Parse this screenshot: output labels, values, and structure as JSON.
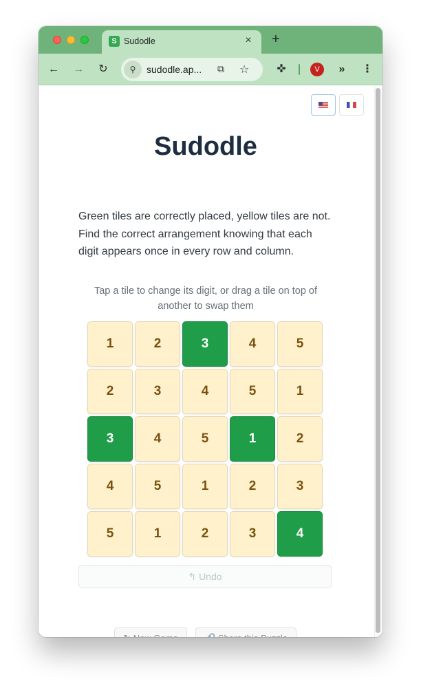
{
  "browser": {
    "tab": {
      "title": "Sudodle",
      "favicon": "S"
    },
    "new_tab": "+",
    "close_tab": "×",
    "url": "sudodle.ap...",
    "avatar_letter": "V",
    "nav": {
      "back": "←",
      "forward": "→",
      "reload": "↻"
    },
    "icons": {
      "site_info": "⚲",
      "install": "⧉",
      "bookmark": "☆",
      "extensions": "✜",
      "more_extensions": "»",
      "menu": "⋮"
    }
  },
  "page": {
    "title": "Sudodle",
    "description": "Green tiles are correctly placed, yellow tiles are not. Find the correct arrangement knowing that each digit appears once in every row and column.",
    "hint": "Tap a tile to change its digit, or drag a tile on top of another to swap them",
    "grid": [
      [
        {
          "v": "1",
          "ok": false
        },
        {
          "v": "2",
          "ok": false
        },
        {
          "v": "3",
          "ok": true
        },
        {
          "v": "4",
          "ok": false
        },
        {
          "v": "5",
          "ok": false
        }
      ],
      [
        {
          "v": "2",
          "ok": false
        },
        {
          "v": "3",
          "ok": false
        },
        {
          "v": "4",
          "ok": false
        },
        {
          "v": "5",
          "ok": false
        },
        {
          "v": "1",
          "ok": false
        }
      ],
      [
        {
          "v": "3",
          "ok": true
        },
        {
          "v": "4",
          "ok": false
        },
        {
          "v": "5",
          "ok": false
        },
        {
          "v": "1",
          "ok": true
        },
        {
          "v": "2",
          "ok": false
        }
      ],
      [
        {
          "v": "4",
          "ok": false
        },
        {
          "v": "5",
          "ok": false
        },
        {
          "v": "1",
          "ok": false
        },
        {
          "v": "2",
          "ok": false
        },
        {
          "v": "3",
          "ok": false
        }
      ],
      [
        {
          "v": "5",
          "ok": false
        },
        {
          "v": "1",
          "ok": false
        },
        {
          "v": "2",
          "ok": false
        },
        {
          "v": "3",
          "ok": false
        },
        {
          "v": "4",
          "ok": true
        }
      ]
    ],
    "undo_label": "↰ Undo",
    "new_game_label": "↻ New Game",
    "share_label": "🔗 Share this Puzzle",
    "colors": {
      "correct": "#1f9d48",
      "misplaced": "#fff1cc",
      "title": "#1e2d40"
    }
  }
}
